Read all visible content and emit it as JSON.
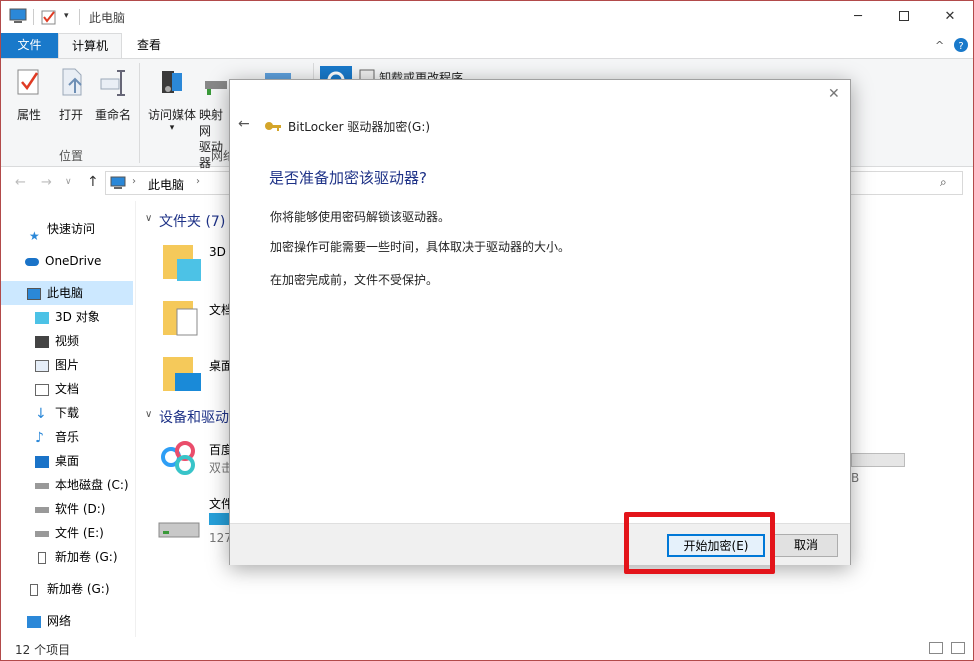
{
  "titlebar": {
    "title": "此电脑"
  },
  "ribbon_tabs": {
    "file": "文件",
    "computer": "计算机",
    "view": "查看"
  },
  "ribbon": {
    "properties": "属性",
    "open": "打开",
    "rename": "重命名",
    "access_media": "访问媒体",
    "map_drive_1": "映射网",
    "map_drive_2": "驱动器",
    "uninstall": "卸载或更改程序",
    "group_location": "位置",
    "group_network": "网络"
  },
  "address": {
    "path": "此电脑"
  },
  "nav": {
    "quick_access": "快速访问",
    "onedrive": "OneDrive",
    "this_pc": "此电脑",
    "objects3d": "3D 对象",
    "videos": "视频",
    "pictures": "图片",
    "documents": "文档",
    "downloads": "下载",
    "music": "音乐",
    "desktop": "桌面",
    "local_c": "本地磁盘 (C:)",
    "soft_d": "软件 (D:)",
    "files_e": "文件 (E:)",
    "new_g": "新加卷 (G:)",
    "new_g2": "新加卷 (G:)",
    "network": "网络"
  },
  "content": {
    "folders_header": "文件夹 (7)",
    "devices_header": "设备和驱动",
    "item_3d": "3D",
    "item_docs": "文档",
    "item_desktop": "桌面",
    "item_baidu": "百度",
    "item_baidu_sub": "双击",
    "item_file": "文件",
    "item_file_sub": "127",
    "right_b": "B"
  },
  "status": {
    "count": "12 个项目"
  },
  "dialog": {
    "title": "BitLocker 驱动器加密(G:)",
    "heading": "是否准备加密该驱动器?",
    "line1": "你将能够使用密码解锁该驱动器。",
    "line2": "加密操作可能需要一些时间，具体取决于驱动器的大小。",
    "line3": "在加密完成前，文件不受保护。",
    "start_button": "开始加密(E)",
    "cancel_button": "取消"
  },
  "colors": {
    "accent": "#1979ca",
    "heading": "#1e3287",
    "highlight": "#e3141a"
  }
}
